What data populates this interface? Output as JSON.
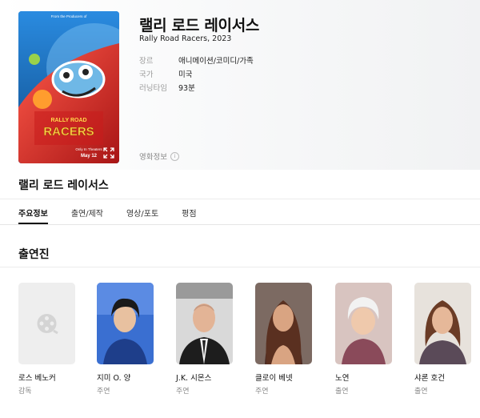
{
  "movie": {
    "title": "랠리 로드 레이서스",
    "subtitle": "Rally Road Racers, 2023",
    "meta": [
      {
        "label": "장르",
        "value": "애니메이션/코미디/가족"
      },
      {
        "label": "국가",
        "value": "미국"
      },
      {
        "label": "러닝타임",
        "value": "93분"
      }
    ],
    "info_link": "영화정보",
    "poster": {
      "top_text": "From the Producers of",
      "logo_line1": "RALLY ROAD",
      "logo_line2": "RACERS",
      "date_line1": "Only In Theaters",
      "date_line2": "May 12"
    }
  },
  "section": {
    "name": "랠리 로드 레이서스"
  },
  "tabs": [
    {
      "label": "주요정보",
      "active": true
    },
    {
      "label": "출연/제작"
    },
    {
      "label": "영상/포토"
    },
    {
      "label": "평점"
    }
  ],
  "cast": {
    "title": "출연진",
    "people": [
      {
        "name": "로스 베노커",
        "role": "감독",
        "photo": "placeholder-film-icon"
      },
      {
        "name": "지미 O. 양",
        "role": "주연"
      },
      {
        "name": "J.K. 시몬스",
        "role": "주연"
      },
      {
        "name": "클로이 베넷",
        "role": "주연"
      },
      {
        "name": "노연",
        "role": "출연"
      },
      {
        "name": "샤론 호건",
        "role": "출연"
      }
    ]
  },
  "colors": {
    "accent": "#111111",
    "muted": "#888888",
    "poster_blue": "#1d6fb6",
    "car_red": "#d92a2a"
  }
}
